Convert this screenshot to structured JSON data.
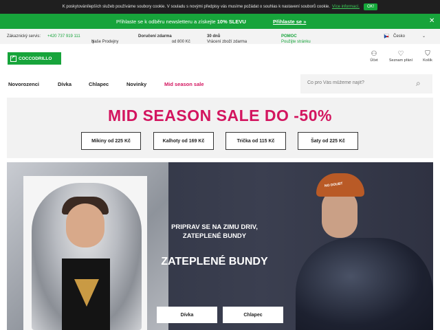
{
  "cookie": {
    "text": "K poskytovánílepších služeb používáme soubory cookie. V souladu s novými předpisy vás musíme požádat o souhlas k nastavení souborů cookie.",
    "link": "Více informací.",
    "ok": "OK!"
  },
  "newsletter": {
    "text": "Přihlaste se k odběru newsletteru a získejte ",
    "bold": "10% SLEVU",
    "cta": "Přihlaste se »",
    "close": "✕"
  },
  "info": {
    "service_label": "Zákaznický servis:",
    "phone": "+420 737 919 111",
    "stores": "Naše Prodejny",
    "shipping_bold": "Doručení zdarma",
    "shipping_rest": "od 800 Kč",
    "returns_text": "Vrácení zboží zdarma ",
    "returns_bold": "30 dnů",
    "help_text": "Použijte stránku ",
    "help_bold": "POMOC",
    "country": "Česko"
  },
  "header": {
    "logo": "COCCODRILLO",
    "account": "Účet",
    "wishlist": "Seznam přání",
    "cart": "Košík"
  },
  "nav": {
    "items": [
      "Novorozenci",
      "Dívka",
      "Chlapec",
      "Novinky",
      "Mid season sale"
    ]
  },
  "search": {
    "placeholder": "Co pro Vás můžeme najít?"
  },
  "sale": {
    "title": "MID SEASON SALE DO -50%",
    "buttons": [
      "Mikiny od 225 Kč",
      "Kalhoty od 169 Kč",
      "Trička od 115 Kč",
      "Šaty od 225 Kč"
    ]
  },
  "hero": {
    "subtitle_line1": "PRIPRAV SE NA ZIMU DRIV,",
    "subtitle_line2": "ZATEPLENÉ BUNDY",
    "title": "ZATEPLENÉ BUNDY",
    "btn_girl": "Dívka",
    "btn_boy": "Chlapec",
    "hat_text": "NO DOUBT"
  },
  "colors": {
    "brand_green": "#17a43b",
    "sale_pink": "#d3155f"
  }
}
